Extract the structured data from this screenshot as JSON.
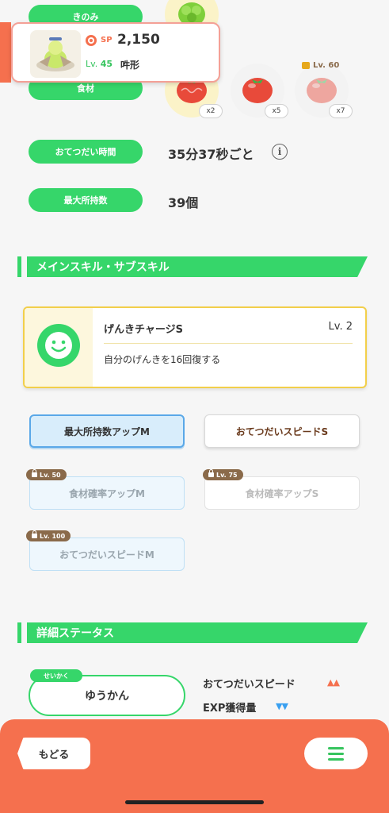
{
  "top": {
    "row1_label": "きのみ",
    "row2_label": "食材",
    "row3_label": "おてつだい時間",
    "row3_value": "35分37秒ごと",
    "row4_label": "最大所持数",
    "row4_value": "39個",
    "ingredients": [
      {
        "qty": "x2",
        "locked": false
      },
      {
        "qty": "x5",
        "locked": false
      },
      {
        "qty": "x7",
        "locked": true,
        "lock_label": "Lv. 60"
      }
    ]
  },
  "pokemon": {
    "sp_label": "SP",
    "sp_value": "2,150",
    "level_prefix": "Lv.",
    "level": "45",
    "name": "吽形"
  },
  "skills": {
    "section_title": "メインスキル・サブスキル",
    "main": {
      "name": "げんきチャージS",
      "level": "Lv. 2",
      "description": "自分のげんきを16回復する"
    },
    "sub": [
      {
        "label": "最大所持数アップM",
        "lock": ""
      },
      {
        "label": "おてつだいスピードS",
        "lock": ""
      },
      {
        "label": "食材確率アップM",
        "lock": "Lv. 50"
      },
      {
        "label": "食材確率アップS",
        "lock": "Lv. 75"
      },
      {
        "label": "おてつだいスピードM",
        "lock": "Lv. 100"
      }
    ]
  },
  "status": {
    "section_title": "詳細ステータス",
    "nature_tag": "せいかく",
    "nature": "ゆうかん",
    "up_stat": "おてつだいスピード",
    "up_arrows": "▲▲",
    "down_stat": "EXP獲得量",
    "down_arrows": "▼▼"
  },
  "nav": {
    "back_label": "もどる"
  },
  "colors": {
    "green": "#36d66a",
    "coral": "#f5704e",
    "gold_border": "#f2cf4a",
    "blue_selected": "#5aa8e8"
  }
}
